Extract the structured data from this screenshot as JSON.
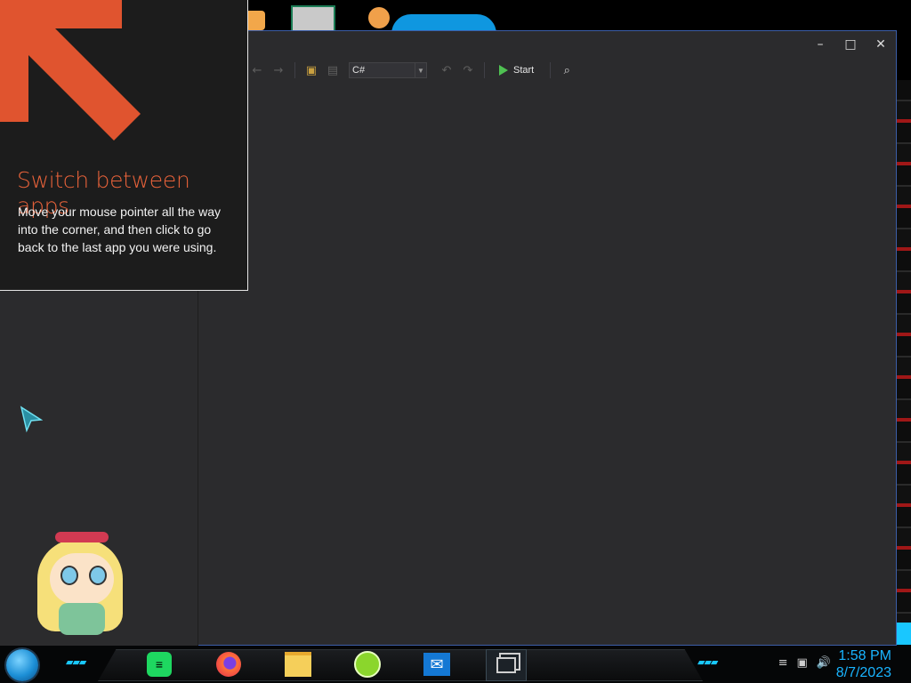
{
  "tip": {
    "title": "Switch between apps",
    "body": "Move your mouse pointer all the way into the corner, and then click to go back to the last app you were using."
  },
  "window": {
    "minimize_icon": "minimize-icon",
    "maximize_icon": "maximize-icon",
    "close_icon": "close-icon"
  },
  "toolbar": {
    "language_value": "C#",
    "start_label": "Start",
    "icons": [
      "back-icon",
      "forward-icon",
      "open-folder-icon",
      "save-icon",
      "undo-icon",
      "redo-icon",
      "find-icon"
    ]
  },
  "taskbar": {
    "apps": [
      "spotify-icon",
      "firefox-icon",
      "file-explorer-icon",
      "lime-app-icon",
      "mail-icon",
      "task-view-icon"
    ],
    "tray_icons": [
      "action-center-icon",
      "network-icon",
      "volume-icon"
    ],
    "time": "1:58 PM",
    "date": "8/7/2023"
  },
  "colors": {
    "accent": "#19b4ff",
    "tip_title": "#e8623a",
    "window_bg": "#2b2b2d",
    "start_green": "#4fc152"
  }
}
